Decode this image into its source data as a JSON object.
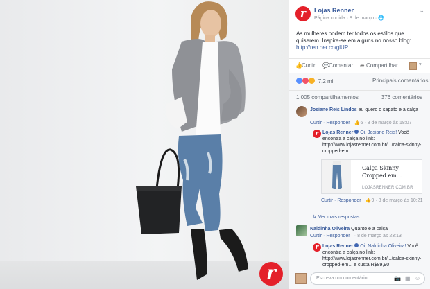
{
  "page": {
    "name": "Lojas Renner",
    "meta": "Página curtida · 8 de março · ",
    "menu_icon": "chevron-down-icon",
    "brand_color": "#e4202a",
    "link_color": "#365899"
  },
  "post": {
    "text": "As mulheres podem ter todos os estilos que quiserem. Inspire-se em alguns no nosso blog:",
    "link": "http://ren.ner.co/glUP"
  },
  "actions": {
    "like": "Curtir",
    "comment": "Comentar",
    "share": "Compartilhar",
    "audience_caret": "▾"
  },
  "reactions": {
    "count": "7,2 mil",
    "sort_label": "Principais comentários ▾"
  },
  "stats": {
    "shares": "1.005 compartilhamentos",
    "comments": "376 comentários"
  },
  "comments": [
    {
      "author": "Josiane Reis Lindos",
      "text": " eu quero o sapato e a calça",
      "actions": "Curtir · Responder · ",
      "likes": "6",
      "time": " · 8 de março às 18:07"
    },
    {
      "author": "Lojas Renner",
      "tag": "Oi, Josiane Reis!",
      "text": " Você encontra a calça no link: http://www.lojasrenner.com.br/.../calca-skinny-cropped-em...",
      "preview_title": "Calça Skinny Cropped em...",
      "preview_domain": "LOJASRENNER.COM.BR",
      "actions": "Curtir · Responder · ",
      "likes": "9",
      "time": " · 8 de março às 10:21"
    },
    {
      "more_replies": "↳ Ver mais respostas"
    },
    {
      "author": "Naldinha Oliveira",
      "text": " Quanto é a calça",
      "actions": "Curtir · Responder · ",
      "likes": "",
      "time": "· 8 de março às 23:13"
    },
    {
      "author": "Lojas Renner",
      "tag": "Oi, Naldinha Oliveira!",
      "text": " Você encontra a calça no link: http://www.lojasrenner.com.br/.../calca-skinny-cropped-em... e custa R$89,90"
    }
  ],
  "composer": {
    "placeholder": "Escreva um comentário..."
  }
}
